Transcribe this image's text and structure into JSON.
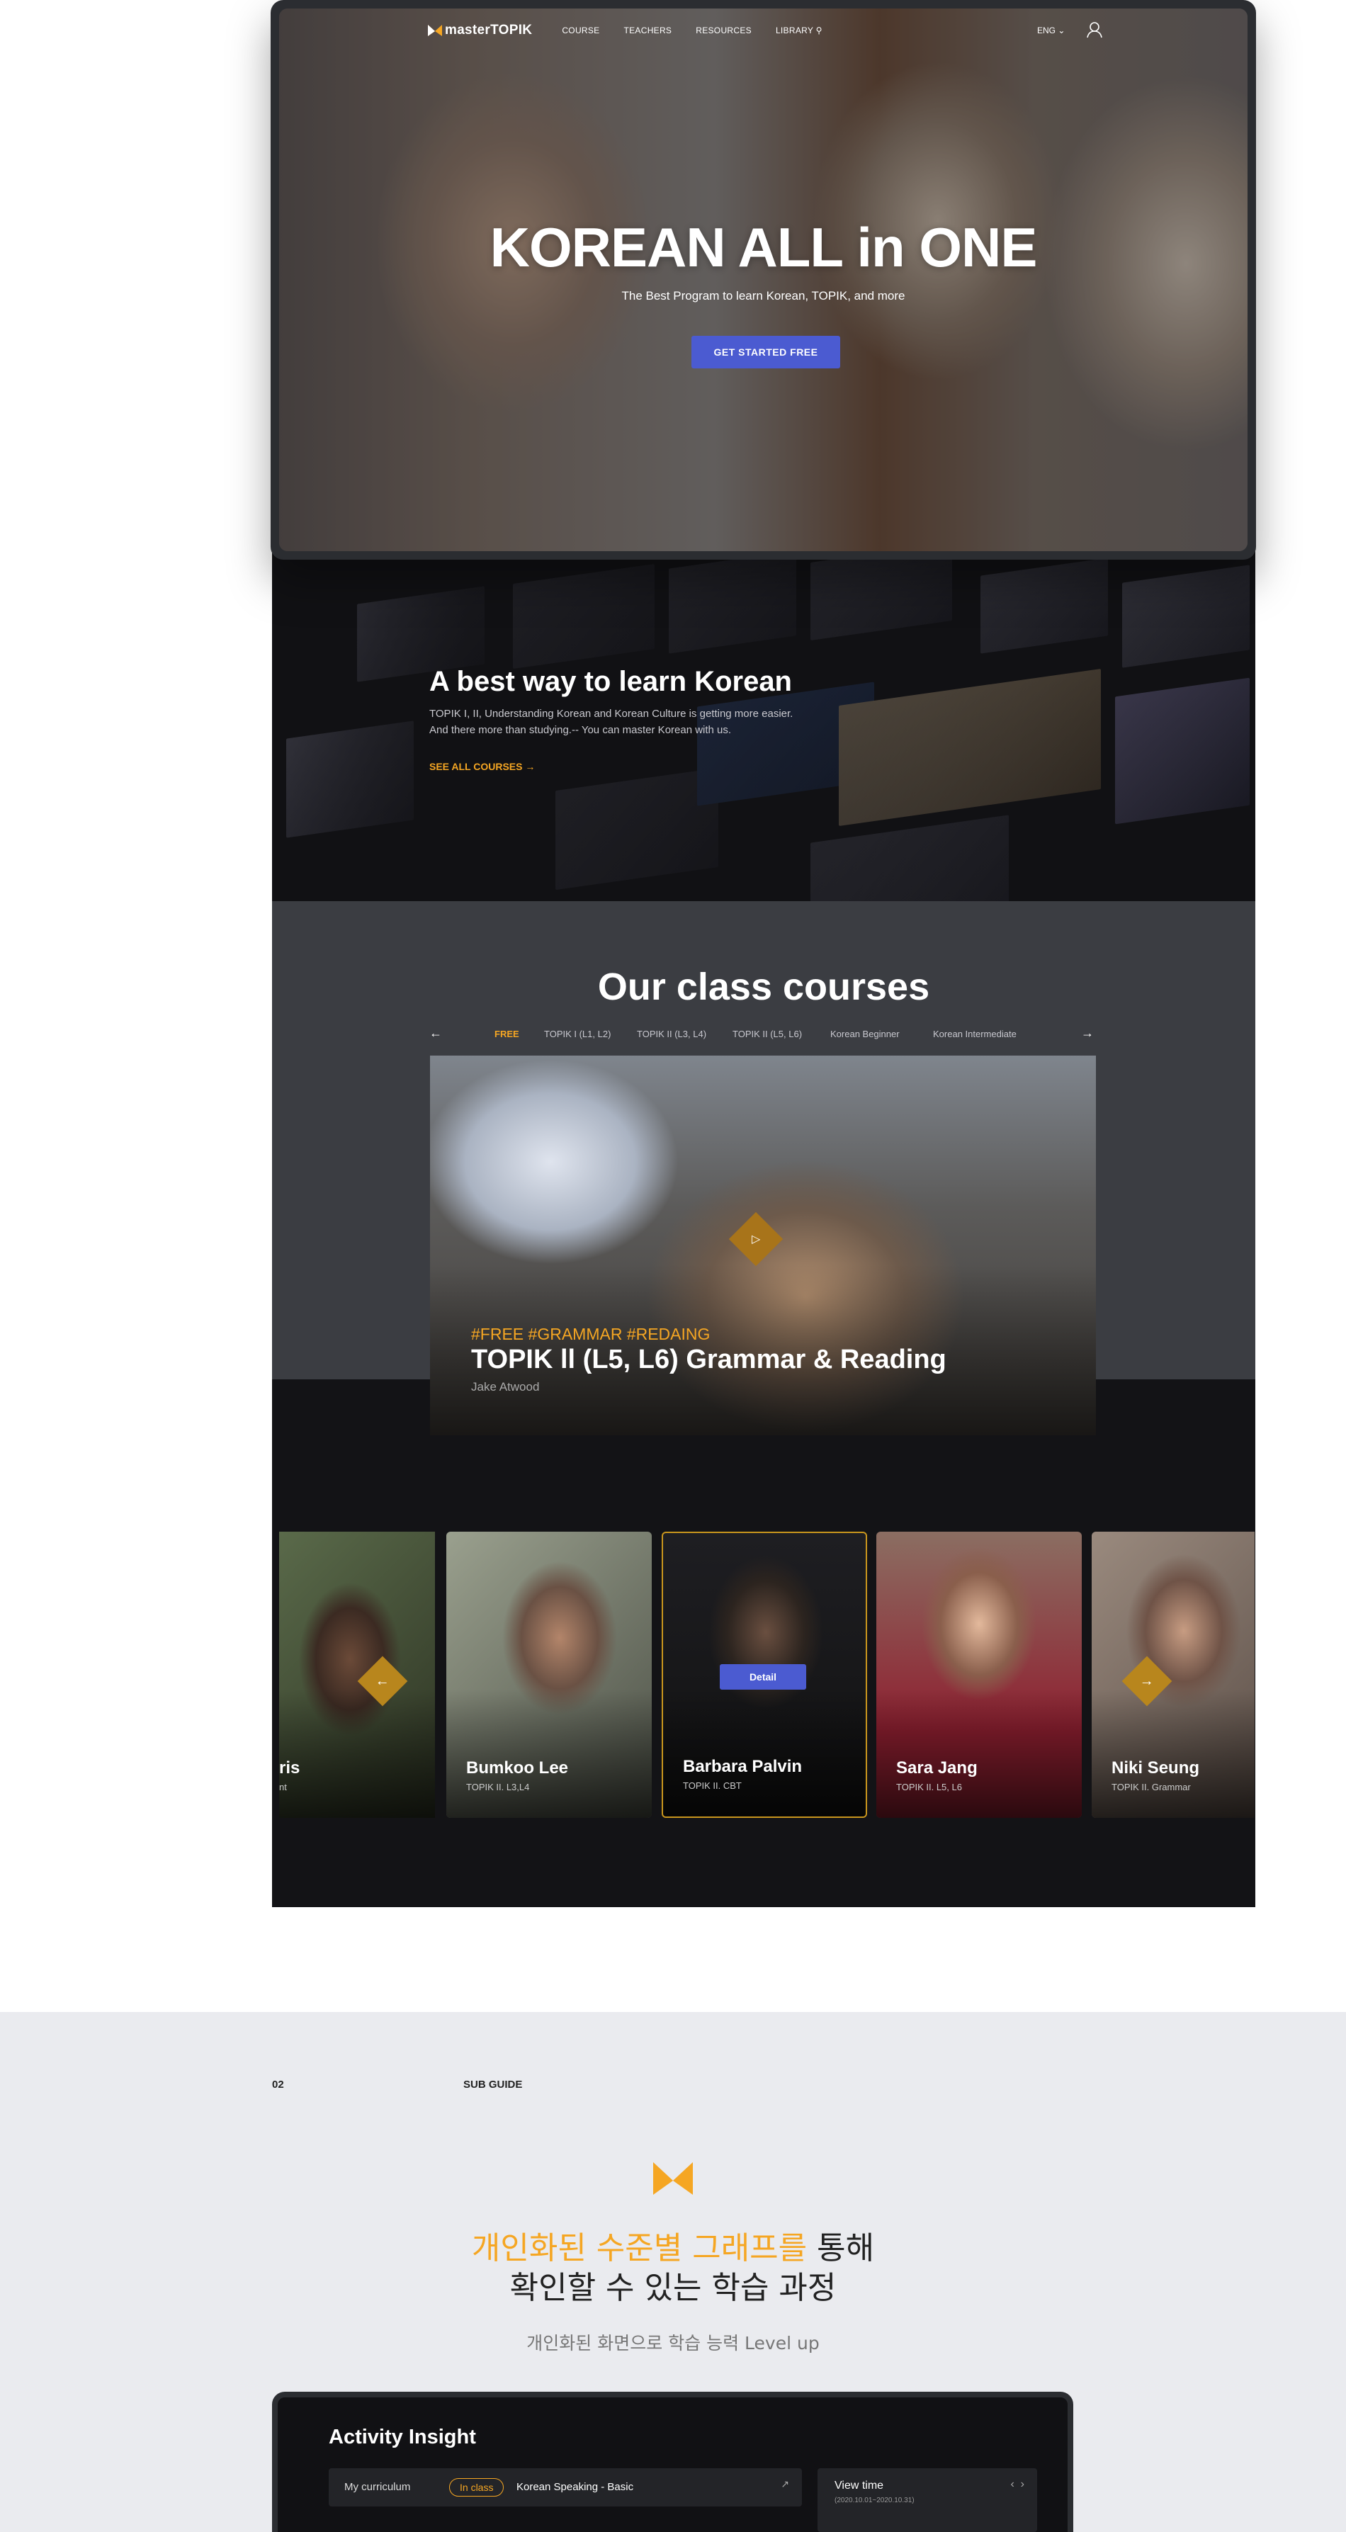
{
  "nav": {
    "brand": "masterTOPIK",
    "links": [
      "COURSE",
      "TEACHERS",
      "RESOURCES",
      "LIBRARY"
    ],
    "lang": "ENG"
  },
  "hero": {
    "title": "KOREAN ALL in ONE",
    "subtitle": "The Best Program to learn Korean, TOPIK, and more",
    "cta": "GET STARTED FREE"
  },
  "intro": {
    "title": "A best way to learn Korean",
    "desc1": "TOPIK I, II, Understanding Korean and Korean Culture is getting more easier.",
    "desc2": "And there more than studying.-- You can master Korean with us.",
    "link": "SEE ALL COURSES"
  },
  "courses": {
    "title": "Our class courses",
    "tabs": [
      "FREE",
      "TOPIK I (L1, L2)",
      "TOPIK II (L3, L4)",
      "TOPIK II (L5, L6)",
      "Korean Beginner",
      "Korean Intermediate"
    ],
    "active_tab": "FREE",
    "featured": {
      "tags": "#FREE  #GRAMMAR  #REDAING",
      "title": "TOPIK ll (L5, L6) Grammar & Reading",
      "author": "Jake Atwood"
    }
  },
  "teachers": {
    "items": [
      {
        "name": "ris",
        "level": "nt"
      },
      {
        "name": "Bumkoo Lee",
        "level": "TOPIK II. L3,L4"
      },
      {
        "name": "Barbara Palvin",
        "level": "TOPIK II. CBT"
      },
      {
        "name": "Sara Jang",
        "level": "TOPIK II. L5, L6"
      },
      {
        "name": "Niki Seung",
        "level": "TOPIK II. Grammar"
      }
    ],
    "detail_label": "Detail"
  },
  "guide": {
    "number": "02",
    "label": "SUB GUIDE",
    "title_hl": "개인화된 수준별 그래프를",
    "title_rest": " 통해",
    "title_line2": "확인할 수 있는 학습 과정",
    "subtitle": "개인화된 화면으로 학습 능력 Level up"
  },
  "insight": {
    "title": "Activity Insight",
    "row_label": "My curriculum",
    "badge": "In class",
    "course": "Korean Speaking - Basic",
    "view_time": "View time",
    "range": "(2020.10.01~2020.10.31)"
  },
  "colors": {
    "accent": "#f5a623",
    "primary": "#4b5bd1"
  }
}
